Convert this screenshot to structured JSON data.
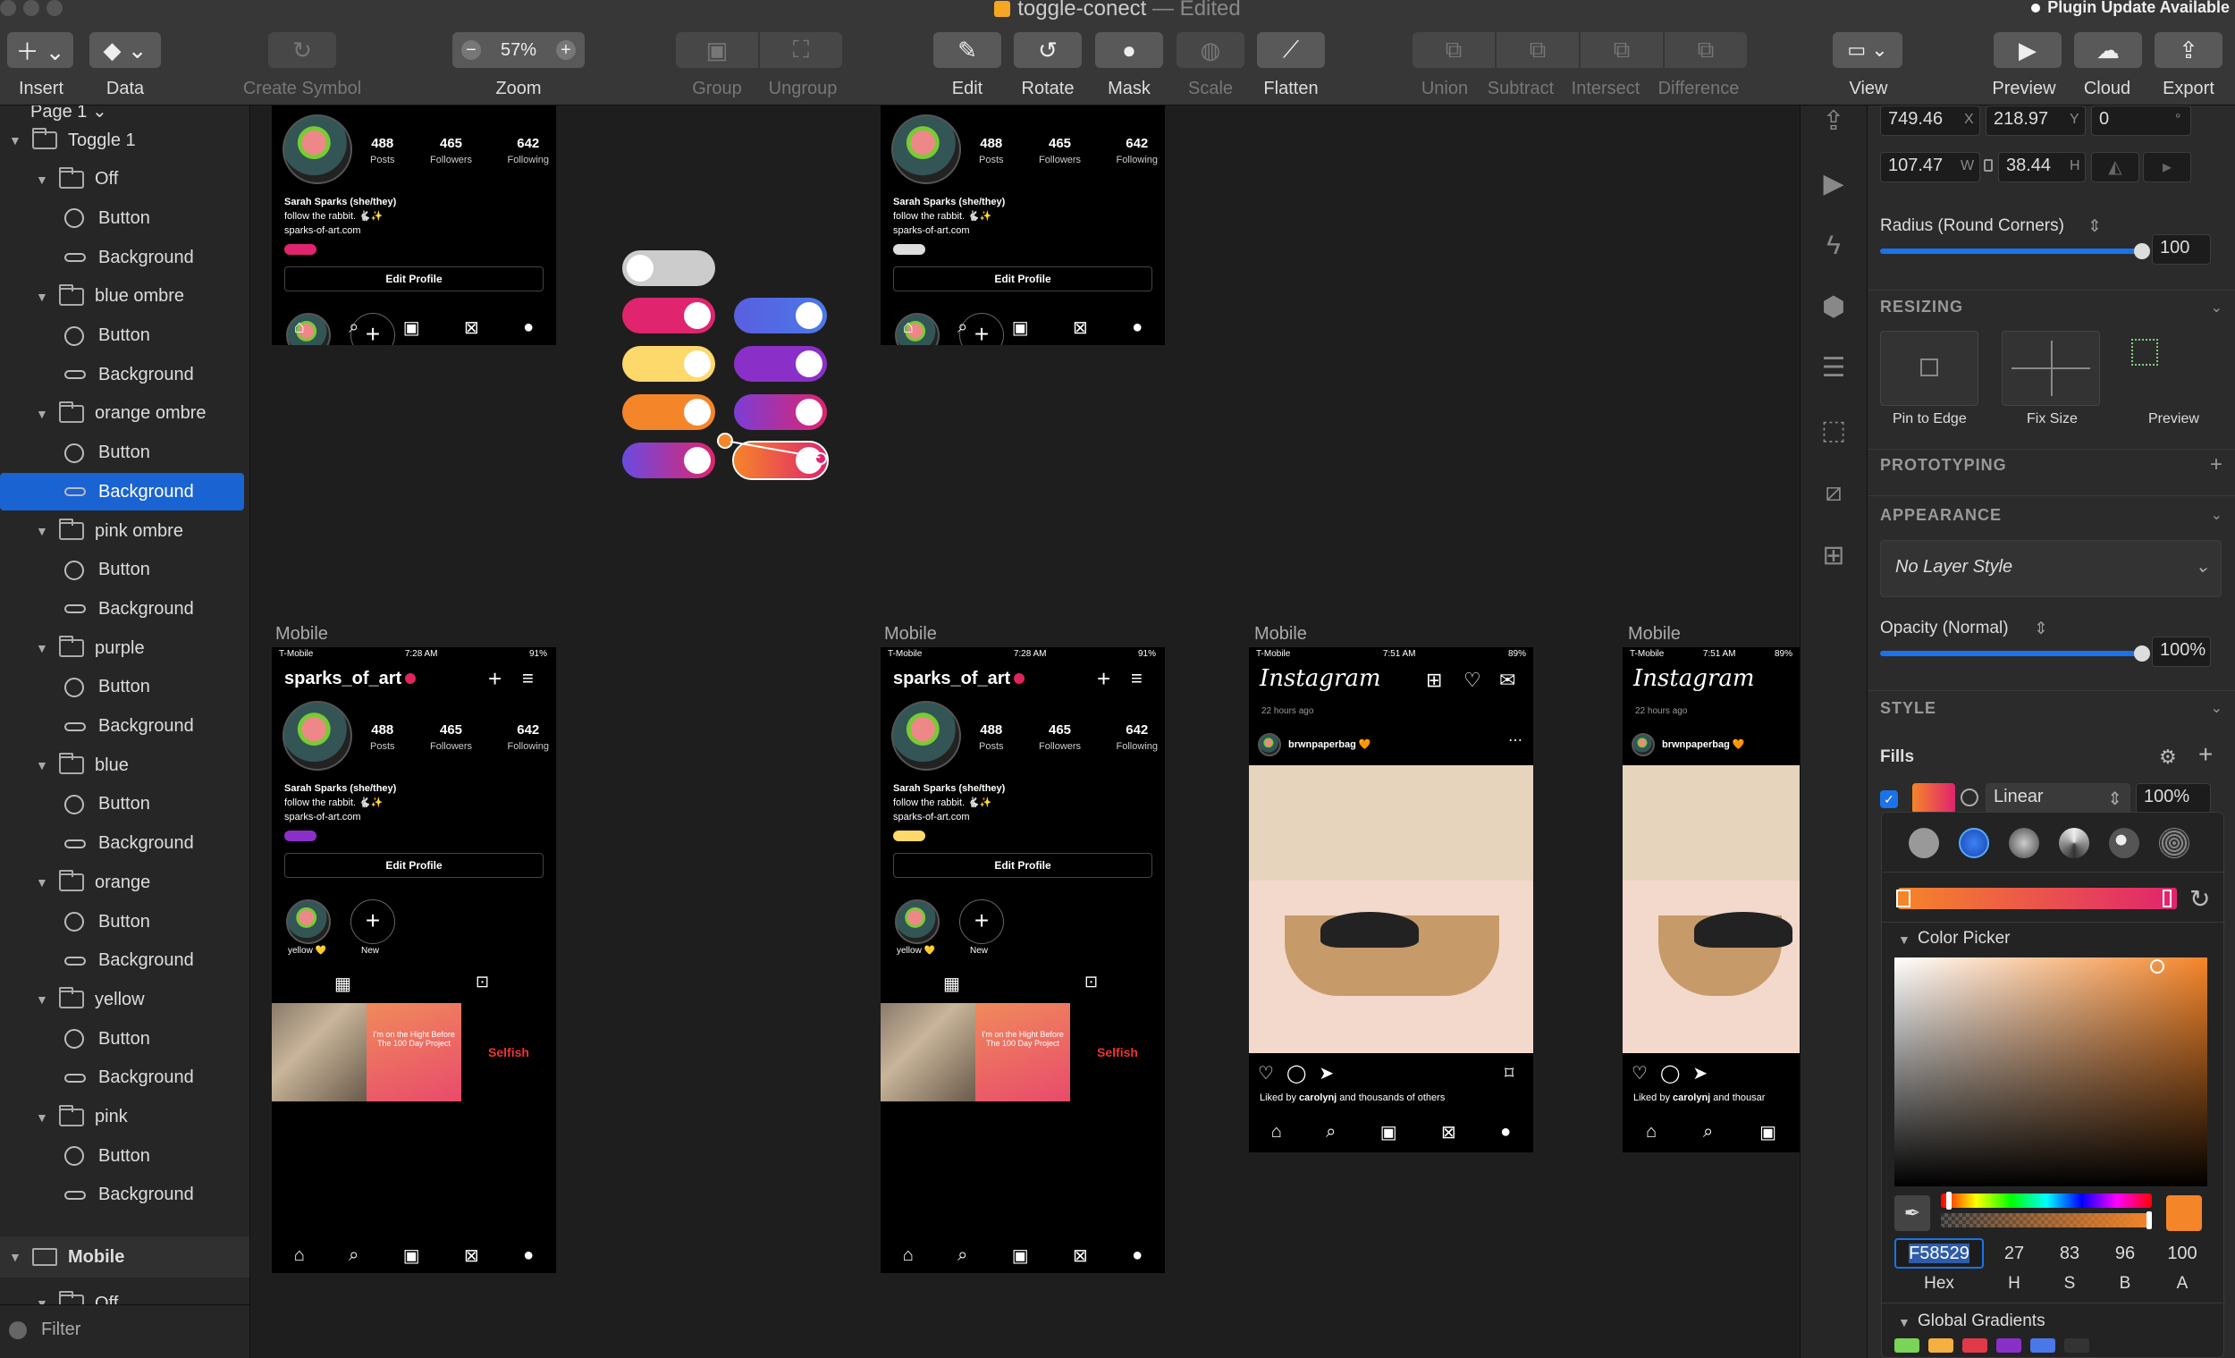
{
  "window": {
    "title": "toggle-conect",
    "status": "— Edited",
    "plugin_notice": "Plugin Update Available"
  },
  "toolbar": {
    "insert": "Insert",
    "data": "Data",
    "create_symbol": "Create Symbol",
    "zoom_label": "Zoom",
    "zoom_value": "57%",
    "zoom_minus": "−",
    "zoom_plus": "+",
    "group": "Group",
    "ungroup": "Ungroup",
    "edit": "Edit",
    "rotate": "Rotate",
    "mask": "Mask",
    "scale": "Scale",
    "flatten": "Flatten",
    "union": "Union",
    "subtract": "Subtract",
    "intersect": "Intersect",
    "difference": "Difference",
    "view": "View",
    "preview": "Preview",
    "cloud": "Cloud",
    "export": "Export"
  },
  "layers": {
    "page": "Page 1 ⌄",
    "groups": [
      {
        "name": "Toggle 1"
      },
      {
        "name": "Off"
      },
      {
        "name": "blue ombre"
      },
      {
        "name": "orange ombre"
      },
      {
        "name": "pink ombre"
      },
      {
        "name": "purple"
      },
      {
        "name": "blue"
      },
      {
        "name": "orange"
      },
      {
        "name": "yellow"
      },
      {
        "name": "pink"
      }
    ],
    "button": "Button",
    "background": "Background",
    "mobile": "Mobile",
    "off2": "Off",
    "filter": "Filter"
  },
  "canvas": {
    "artboard_label": "Mobile",
    "profile": {
      "username": "sparks_of_art",
      "posts": "488",
      "posts_lbl": "Posts",
      "followers": "465",
      "followers_lbl": "Followers",
      "following": "642",
      "following_lbl": "Following",
      "bio1": "Sarah Sparks (she/they)",
      "bio2": "follow the rabbit. 🐇✨",
      "bio3": "sparks-of-art.com",
      "edit": "Edit Profile",
      "hl1": "yellow 💛",
      "hl2": "New",
      "status_carrier": "T-Mobile",
      "status_time": "7:28 AM",
      "status_batt": "91%",
      "tile2": "I'm on the Hight Before The 100 Day Project",
      "tile3": "Selfish"
    },
    "feed": {
      "brand": "Instagram",
      "time": "7:51 AM",
      "batt": "89%",
      "ago": "22 hours ago",
      "user": "brwnpaperbag 🧡",
      "liked_prefix": "Liked by",
      "liked_user": "carolynj",
      "liked_suffix": "and thousands of others",
      "liked_trunc": "and thousar"
    }
  },
  "inspector": {
    "x": "749.46",
    "x_sfx": "X",
    "y": "218.97",
    "y_sfx": "Y",
    "rot": "0",
    "rot_sfx": "°",
    "w": "107.47",
    "w_sfx": "W",
    "h": "38.44",
    "h_sfx": "H",
    "radius_label": "Radius (Round Corners)",
    "radius_value": "100",
    "resizing": "RESIZING",
    "pin": "Pin to Edge",
    "fix": "Fix Size",
    "preview": "Preview",
    "prototyping": "PROTOTYPING",
    "appearance": "APPEARANCE",
    "layer_style": "No Layer Style",
    "opacity_label": "Opacity (Normal)",
    "opacity_value": "100%",
    "style": "STYLE",
    "fills": "Fills",
    "fill_type": "Linear",
    "fill_opacity": "100%",
    "color_picker": "Color Picker",
    "hex": "F58529",
    "hue": "27",
    "sat": "83",
    "bri": "96",
    "alpha": "100",
    "hex_cap": "Hex",
    "h_cap": "H",
    "s_cap": "S",
    "b_cap": "B",
    "a_cap": "A",
    "global_gradients": "Global Gradients",
    "colors": {
      "accent": "#F58529",
      "selection": "#1A63D2",
      "pink": "#E0245E",
      "purple": "#8B2FC9"
    }
  }
}
